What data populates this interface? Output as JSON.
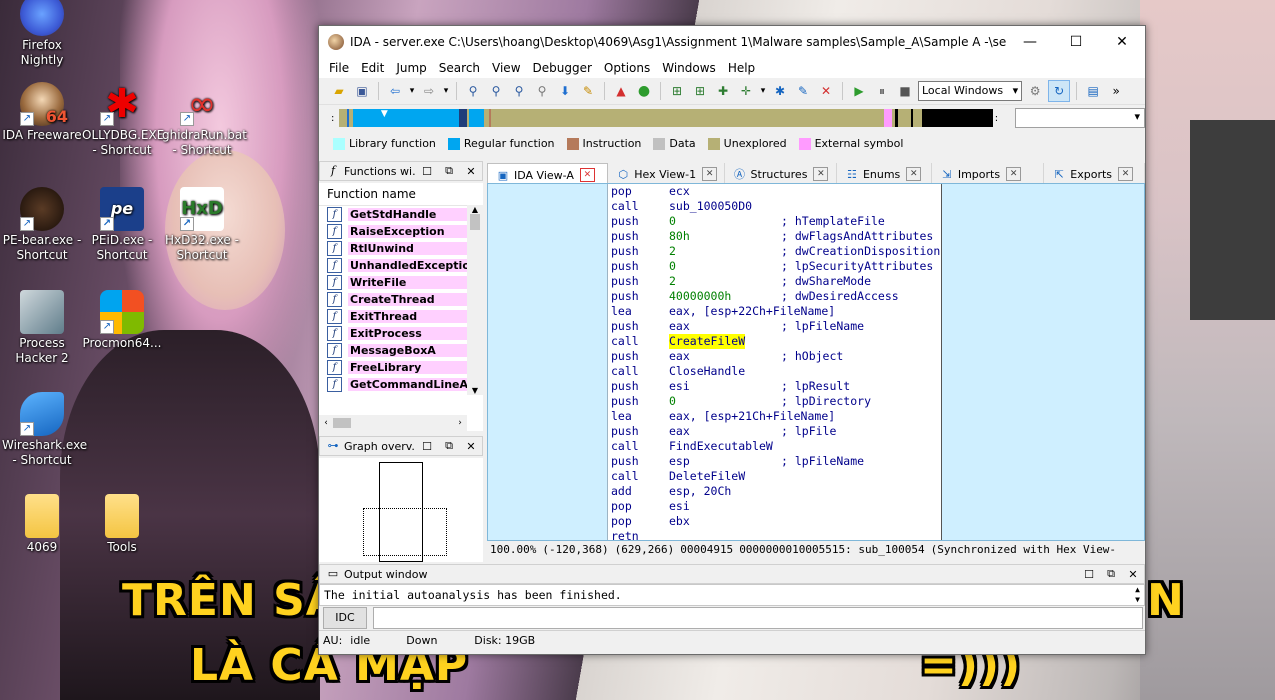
{
  "desktop": {
    "icons": [
      {
        "label": "Firefox Nightly"
      },
      {
        "label": "IDA Freeware"
      },
      {
        "label": "OLLYDBG.EXE - Shortcut"
      },
      {
        "label": "ghidraRun.bat - Shortcut"
      },
      {
        "label": "PE-bear.exe - Shortcut"
      },
      {
        "label": "PEiD.exe - Shortcut"
      },
      {
        "label": "HxD32.exe - Shortcut"
      },
      {
        "label": "Process Hacker 2"
      },
      {
        "label": "Procmon64..."
      },
      {
        "label": "Wireshark.exe - Shortcut"
      },
      {
        "label": "4069"
      },
      {
        "label": "Tools"
      }
    ],
    "caption_left_line1": "TRÊN SÂ",
    "caption_right_line1": "N",
    "caption_left_line2": "LÀ CÁ MẬP",
    "caption_right_line2": "=)))"
  },
  "window": {
    "title": "IDA - server.exe C:\\Users\\hoang\\Desktop\\4069\\Asg1\\Assignment 1\\Malware samples\\Sample_A\\Sample A -\\server.exe",
    "controls": {
      "minimize": "—",
      "maximize": "☐",
      "close": "✕"
    }
  },
  "menu": [
    "File",
    "Edit",
    "Jump",
    "Search",
    "View",
    "Debugger",
    "Options",
    "Windows",
    "Help"
  ],
  "toolbar": {
    "debugger_select": "Local Windows"
  },
  "legend": [
    {
      "label": "Library function",
      "color": "#aaffff"
    },
    {
      "label": "Regular function",
      "color": "#00a6f0"
    },
    {
      "label": "Instruction",
      "color": "#b57a5b"
    },
    {
      "label": "Data",
      "color": "#c0c0c0"
    },
    {
      "label": "Unexplored",
      "color": "#b6b075"
    },
    {
      "label": "External symbol",
      "color": "#ff9bff"
    }
  ],
  "functions_pane": {
    "title": "Functions wi...",
    "column_header": "Function name",
    "items": [
      "GetStdHandle",
      "RaiseException",
      "RtlUnwind",
      "UnhandledException",
      "WriteFile",
      "CreateThread",
      "ExitThread",
      "ExitProcess",
      "MessageBoxA",
      "FreeLibrary",
      "GetCommandLineA"
    ]
  },
  "graph_pane": {
    "title": "Graph overv..."
  },
  "tabs": [
    {
      "label": "IDA View-A",
      "icon": "ida-view-icon"
    },
    {
      "label": "Hex View-1",
      "icon": "hex-view-icon"
    },
    {
      "label": "Structures",
      "icon": "structures-icon"
    },
    {
      "label": "Enums",
      "icon": "enums-icon"
    },
    {
      "label": "Imports",
      "icon": "imports-icon"
    },
    {
      "label": "Exports",
      "icon": "exports-icon"
    }
  ],
  "disasm": [
    {
      "mn": "pop",
      "op": "ecx",
      "cmt": ""
    },
    {
      "mn": "call",
      "op": "sub_100050D0",
      "cmt": ""
    },
    {
      "mn": "push",
      "op": "0",
      "cmt": "; hTemplateFile",
      "numop": true
    },
    {
      "mn": "push",
      "op": "80h",
      "cmt": "; dwFlagsAndAttributes",
      "numop": true
    },
    {
      "mn": "push",
      "op": "2",
      "cmt": "; dwCreationDisposition",
      "numop": true
    },
    {
      "mn": "push",
      "op": "0",
      "cmt": "; lpSecurityAttributes",
      "numop": true
    },
    {
      "mn": "push",
      "op": "2",
      "cmt": "; dwShareMode",
      "numop": true
    },
    {
      "mn": "push",
      "op": "40000000h",
      "cmt": "; dwDesiredAccess",
      "numop": true
    },
    {
      "mn": "lea",
      "op": "eax, [esp+22Ch+FileName]",
      "cmt": ""
    },
    {
      "mn": "push",
      "op": "eax",
      "cmt": "; lpFileName"
    },
    {
      "mn": "call",
      "op": "CreateFileW",
      "cmt": "",
      "highlight": true
    },
    {
      "mn": "push",
      "op": "eax",
      "cmt": "; hObject"
    },
    {
      "mn": "call",
      "op": "CloseHandle",
      "cmt": ""
    },
    {
      "mn": "push",
      "op": "esi",
      "cmt": "; lpResult"
    },
    {
      "mn": "push",
      "op": "0",
      "cmt": "; lpDirectory",
      "numop": true
    },
    {
      "mn": "lea",
      "op": "eax, [esp+21Ch+FileName]",
      "cmt": ""
    },
    {
      "mn": "push",
      "op": "eax",
      "cmt": "; lpFile"
    },
    {
      "mn": "call",
      "op": "FindExecutableW",
      "cmt": ""
    },
    {
      "mn": "push",
      "op": "esp",
      "cmt": "; lpFileName"
    },
    {
      "mn": "call",
      "op": "DeleteFileW",
      "cmt": ""
    },
    {
      "mn": "add",
      "op": "esp, 20Ch",
      "cmt": ""
    },
    {
      "mn": "pop",
      "op": "esi",
      "cmt": ""
    },
    {
      "mn": "pop",
      "op": "ebx",
      "cmt": ""
    },
    {
      "mn": "retn",
      "op": "",
      "cmt": ""
    }
  ],
  "view_status": {
    "zoom": "100.00%",
    "coords": "(-120,368)",
    "pos": "(629,266)",
    "offset": "00004915",
    "address": "0000000010005515: sub_100054",
    "sync": "(Synchronized with Hex View-"
  },
  "output": {
    "title": "Output window",
    "message": "The initial autoanalysis has been finished.",
    "idc_button": "IDC"
  },
  "status": {
    "au": "AU:",
    "state": "idle",
    "direction": "Down",
    "disk": "Disk: 19GB"
  }
}
